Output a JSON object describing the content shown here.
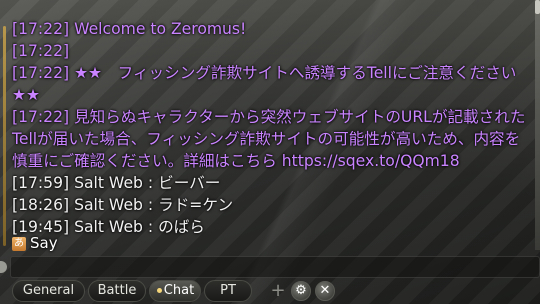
{
  "messages": [
    {
      "time": "[17:22]",
      "text": "Welcome to Zeromus!"
    },
    {
      "time": "[17:22]",
      "text": ""
    },
    {
      "time": "[17:22]",
      "text": "★★　フィッシング詐欺サイトへ誘導するTellにご注意ください　★★"
    },
    {
      "time": "[17:22]",
      "text": "見知らぬキャラクターから突然ウェブサイトのURLが記載されたTellが届いた場合、フィッシング詐欺サイトの可能性が高いため、内容を慎重にご確認ください。詳細はこちら https://sqex.to/QQm18"
    },
    {
      "time": "[17:59]",
      "sender": "Salt Web",
      "separator": " : ",
      "text": "ビーバー"
    },
    {
      "time": "[18:26]",
      "sender": "Salt Web",
      "separator": " : ",
      "text": "ラド=ケン"
    },
    {
      "time": "[19:45]",
      "sender": "Salt Web",
      "separator": " : ",
      "text": "のばら"
    }
  ],
  "input": {
    "channel_badge": "あ",
    "channel": "Say",
    "value": ""
  },
  "tabs": [
    "General",
    "Battle",
    "Chat",
    "PT"
  ],
  "active_tab": "Chat",
  "icons": [
    "plus-icon",
    "gear-icon",
    "close-icon"
  ],
  "colors": {
    "system_text": "#c983ff",
    "say_text": "#f2f2f2"
  }
}
